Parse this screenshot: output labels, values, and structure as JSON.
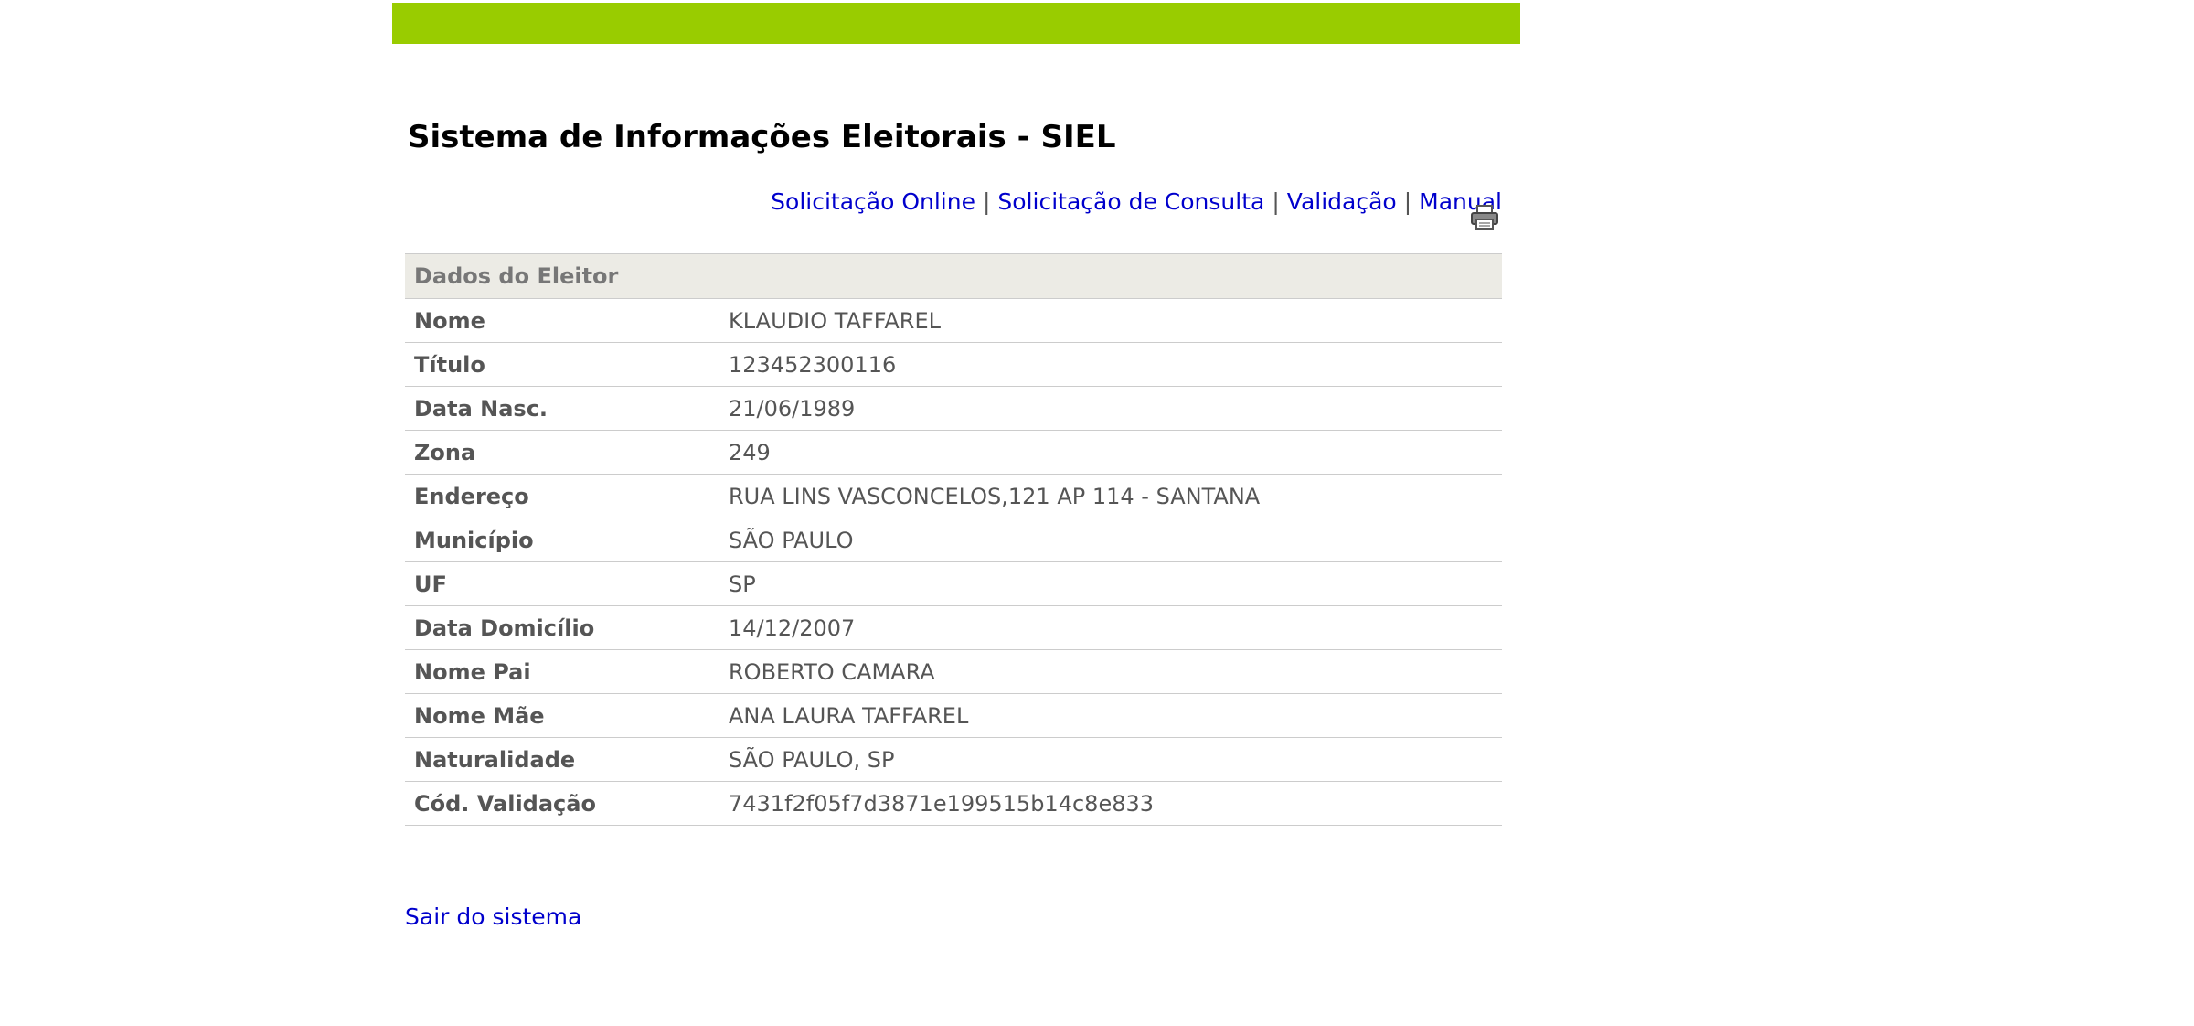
{
  "header": {
    "title": "Sistema de Informações Eleitorais - SIEL",
    "accent_color": "#99cc00"
  },
  "nav": {
    "links": [
      {
        "label": "Solicitação Online"
      },
      {
        "label": "Solicitação de Consulta"
      },
      {
        "label": "Validação"
      },
      {
        "label": "Manual"
      }
    ],
    "separator": "|",
    "print_icon": "printer-icon"
  },
  "voter": {
    "section_title": "Dados do Eleitor",
    "rows": [
      {
        "label": "Nome",
        "value": "KLAUDIO TAFFAREL"
      },
      {
        "label": "Título",
        "value": "123452300116"
      },
      {
        "label": "Data Nasc.",
        "value": "21/06/1989"
      },
      {
        "label": "Zona",
        "value": "249"
      },
      {
        "label": "Endereço",
        "value": "RUA LINS VASCONCELOS,121 AP 114 - SANTANA"
      },
      {
        "label": "Município",
        "value": "SÃO PAULO"
      },
      {
        "label": "UF",
        "value": "SP"
      },
      {
        "label": "Data Domicílio",
        "value": "14/12/2007"
      },
      {
        "label": "Nome Pai",
        "value": "ROBERTO CAMARA"
      },
      {
        "label": "Nome Mãe",
        "value": "ANA LAURA TAFFAREL"
      },
      {
        "label": "Naturalidade",
        "value": "SÃO PAULO, SP"
      },
      {
        "label": "Cód. Validação",
        "value": "7431f2f05f7d3871e199515b14c8e833"
      }
    ]
  },
  "footer": {
    "logout_label": "Sair do sistema"
  }
}
